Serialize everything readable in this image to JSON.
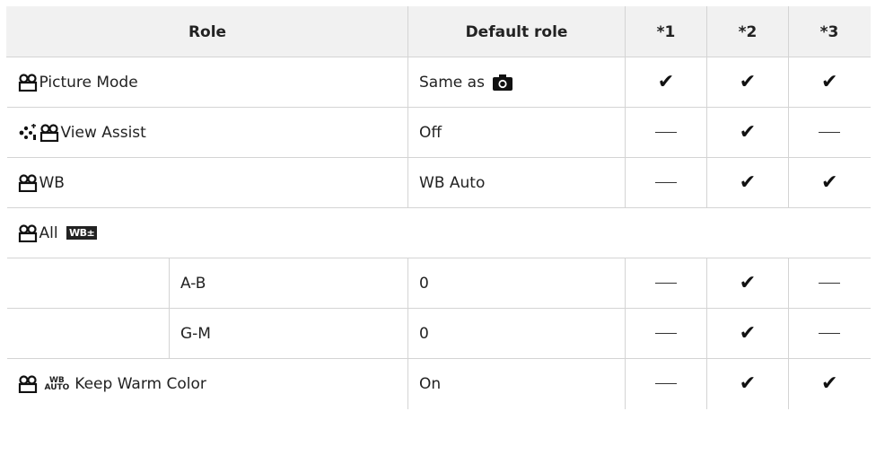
{
  "headers": {
    "role": "Role",
    "default_role": "Default role",
    "col1": "*1",
    "col2": "*2",
    "col3": "*3"
  },
  "rows": [
    {
      "role": "Picture Mode",
      "icons": [
        "movie-icon"
      ],
      "default": "Same as ",
      "default_icon": "camera-icon",
      "marks": [
        "check",
        "check",
        "check"
      ]
    },
    {
      "role": "View Assist",
      "icons": [
        "view-assist-icon",
        "movie-icon"
      ],
      "default": "Off",
      "marks": [
        "dash",
        "check",
        "dash"
      ]
    },
    {
      "role": "WB",
      "icons": [
        "movie-icon"
      ],
      "default": "WB Auto",
      "marks": [
        "dash",
        "check",
        "check"
      ]
    },
    {
      "role": "All ",
      "icons": [
        "movie-icon",
        "wb-shift-icon"
      ],
      "badge": "WB±",
      "group": true
    },
    {
      "sub_role": "A-B",
      "default": "0",
      "marks": [
        "dash",
        "check",
        "dash"
      ]
    },
    {
      "sub_role": "G-M",
      "default": "0",
      "marks": [
        "dash",
        "check",
        "dash"
      ]
    },
    {
      "role": "Keep Warm Color",
      "icons": [
        "movie-icon",
        "wb-auto-icon"
      ],
      "badge_top": "WB",
      "badge_bottom": "AUTO",
      "default": "On",
      "marks": [
        "dash",
        "check",
        "check"
      ]
    }
  ],
  "check_glyph": "✔"
}
